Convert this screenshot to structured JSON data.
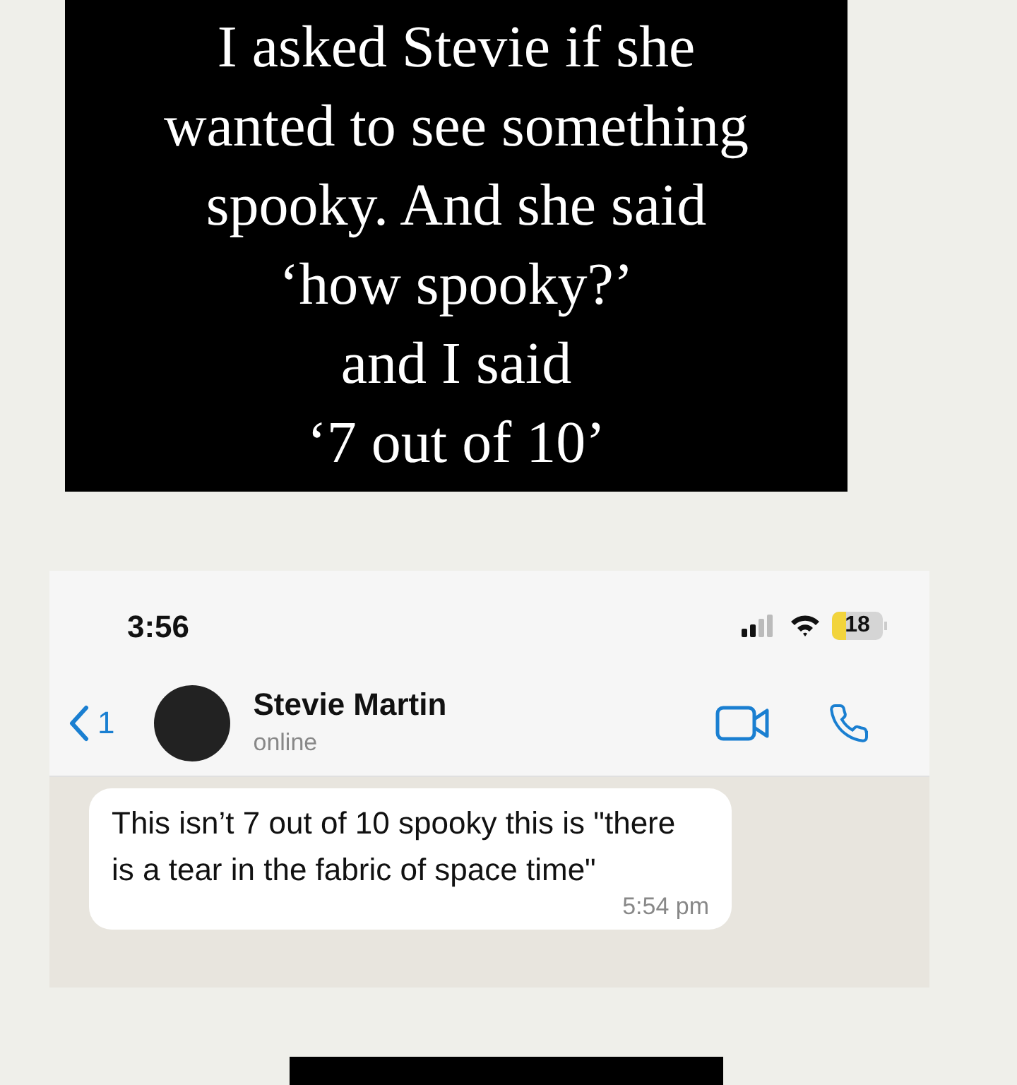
{
  "caption": {
    "lines": [
      "I asked Stevie if she",
      "wanted to see something",
      "spooky. And she said",
      "‘how spooky?’",
      "and I said",
      "‘7 out of 10’"
    ]
  },
  "phone": {
    "status_bar": {
      "time": "3:56",
      "battery": "18"
    },
    "chat_header": {
      "back_count": "1",
      "name": "Stevie Martin",
      "status": "online"
    },
    "messages": [
      {
        "text": "This isn’t 7 out of 10 spooky this is \"there is a tear in the fabric of space time\"",
        "time": "5:54 pm"
      }
    ]
  }
}
